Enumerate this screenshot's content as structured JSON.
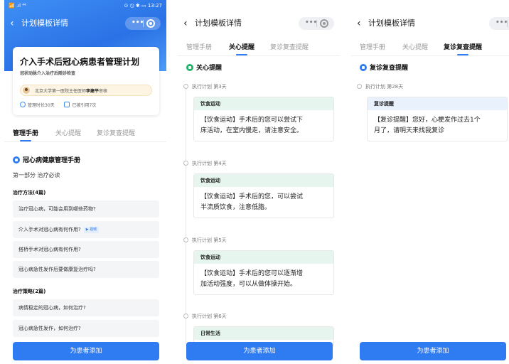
{
  "colors": {
    "primary": "#2f7bf1",
    "green_icon": "#1fb56a",
    "blue_icon": "#2f7bf1",
    "green_header": "#e6f6ee",
    "blue_header": "#e9f1fd"
  },
  "status_bar": {
    "left": "📶 .ıl ⁴⁶",
    "right": "⊙ ◷ ✱ ▭ 13:27"
  },
  "nav": {
    "title": "计划模板详情",
    "back_icon": "chevron-left-icon",
    "menu_icon": "more-dots-icon",
    "close_icon": "capsule-close-icon"
  },
  "tabs": [
    "管理手册",
    "关心提醒",
    "复诊复查提醒"
  ],
  "plan": {
    "title": "介入手术后冠心病患者管理计划",
    "subtitle": "冠状动脉介入治疗后随诊检查",
    "doctor_prefix": "北京大学第一医院主任医师",
    "doctor_name": "李建平",
    "doctor_suffix": "审核",
    "duration": "管理时长30天",
    "usage": "已被引用7次"
  },
  "manual": {
    "section_title": "冠心病健康管理手册",
    "part_title": "第一部分 治疗必读",
    "categories": [
      {
        "title": "治疗方法(4篇)",
        "items": [
          "治疗冠心病，可能会用到哪些药物?",
          "介入手术对冠心病有何作用?",
          "搭桥手术对冠心病有何作用?",
          "冠心病急性发作后要做康复治疗吗?"
        ]
      },
      {
        "title": "治疗策略(2篇)",
        "items": [
          "病情稳定的冠心病，如何治疗?",
          "冠心病急性发作，如何治疗?"
        ]
      }
    ],
    "video_tag": "▶ 视频"
  },
  "care": {
    "section_title": "关心提醒",
    "entries": [
      {
        "label": "执行计划 第3天",
        "type": "饮食运动",
        "text_lines": [
          "【饮食运动】手术后的您可以尝试下",
          "床活动，在室内慢走，请注意安全。"
        ]
      },
      {
        "label": "执行计划 第4天",
        "type": "饮食运动",
        "text_lines": [
          "【饮食运动】手术后的您，可以尝试",
          "半流质饮食，注意低脂。"
        ]
      },
      {
        "label": "执行计划 第5天",
        "type": "饮食运动",
        "text_lines": [
          "【饮食运动】手术后的您可以逐渐增",
          "加活动强度，可以从做体操开始。"
        ]
      },
      {
        "label": "执行计划 第6天",
        "type": "日常生活",
        "text_lines": []
      }
    ]
  },
  "followup": {
    "section_title": "复诊复查提醒",
    "entries": [
      {
        "label": "执行计划 第28天",
        "type": "复诊提醒",
        "text_lines": [
          "【复诊提醒】您好，心梗发作过去1个",
          "月了，请明天来找我复诊"
        ]
      }
    ]
  },
  "action_button": "为患者添加"
}
